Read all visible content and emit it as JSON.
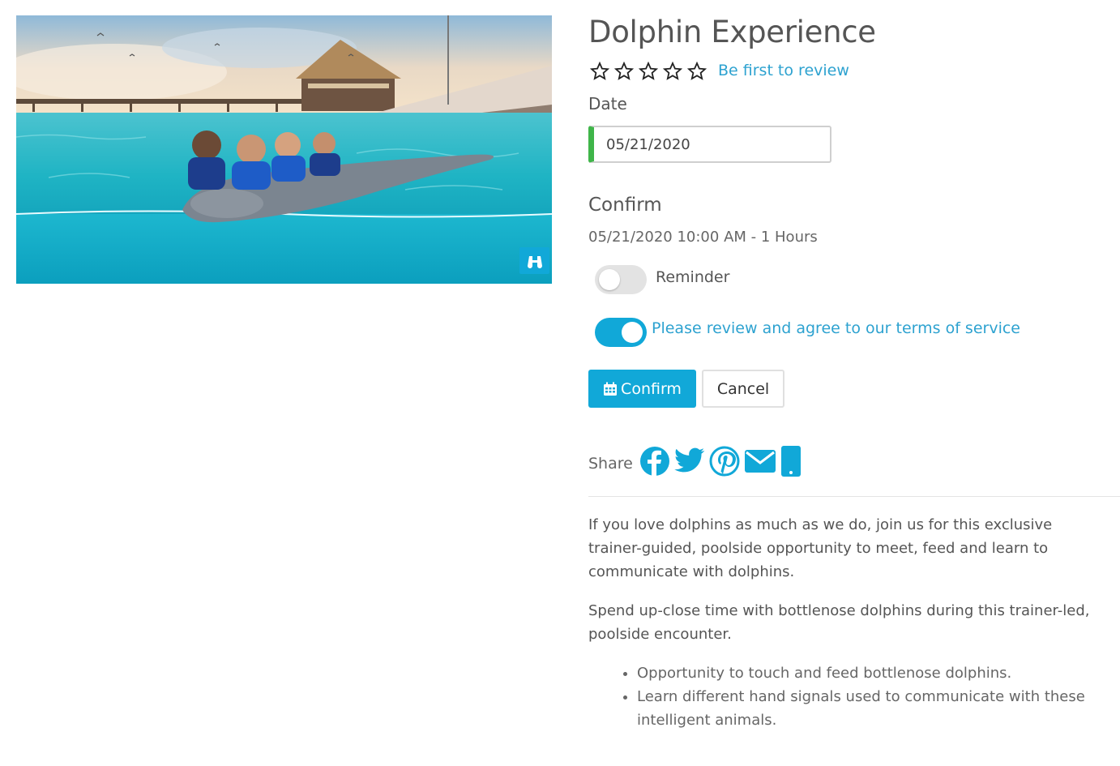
{
  "product": {
    "title": "Dolphin Experience",
    "rating_stars": 5,
    "review_link": "Be first to review"
  },
  "booking": {
    "date_label": "Date",
    "date_value": "05/21/2020",
    "confirm_heading": "Confirm",
    "confirm_detail": "05/21/2020 10:00 AM - 1 Hours",
    "reminder_label": "Reminder",
    "reminder_on": false,
    "terms_label": "Please review and agree to our terms of service",
    "terms_on": true,
    "confirm_button": "Confirm",
    "cancel_button": "Cancel"
  },
  "share": {
    "label": "Share",
    "icons": [
      "facebook-icon",
      "twitter-icon",
      "pinterest-icon",
      "email-icon",
      "mobile-icon"
    ]
  },
  "description": {
    "paragraphs": [
      "If you love dolphins as much as we do, join us for this exclusive trainer-guided, poolside opportunity to meet, feed and learn to communicate with dolphins.",
      "Spend up-close time with bottlenose dolphins during this trainer-led, poolside encounter."
    ],
    "bullets": [
      "Opportunity to touch and feed bottlenose dolphins.",
      "Learn different hand signals used to communicate with these intelligent animals."
    ]
  },
  "colors": {
    "accent": "#11a8d8",
    "link": "#2da2d0",
    "valid": "#3fb549"
  }
}
